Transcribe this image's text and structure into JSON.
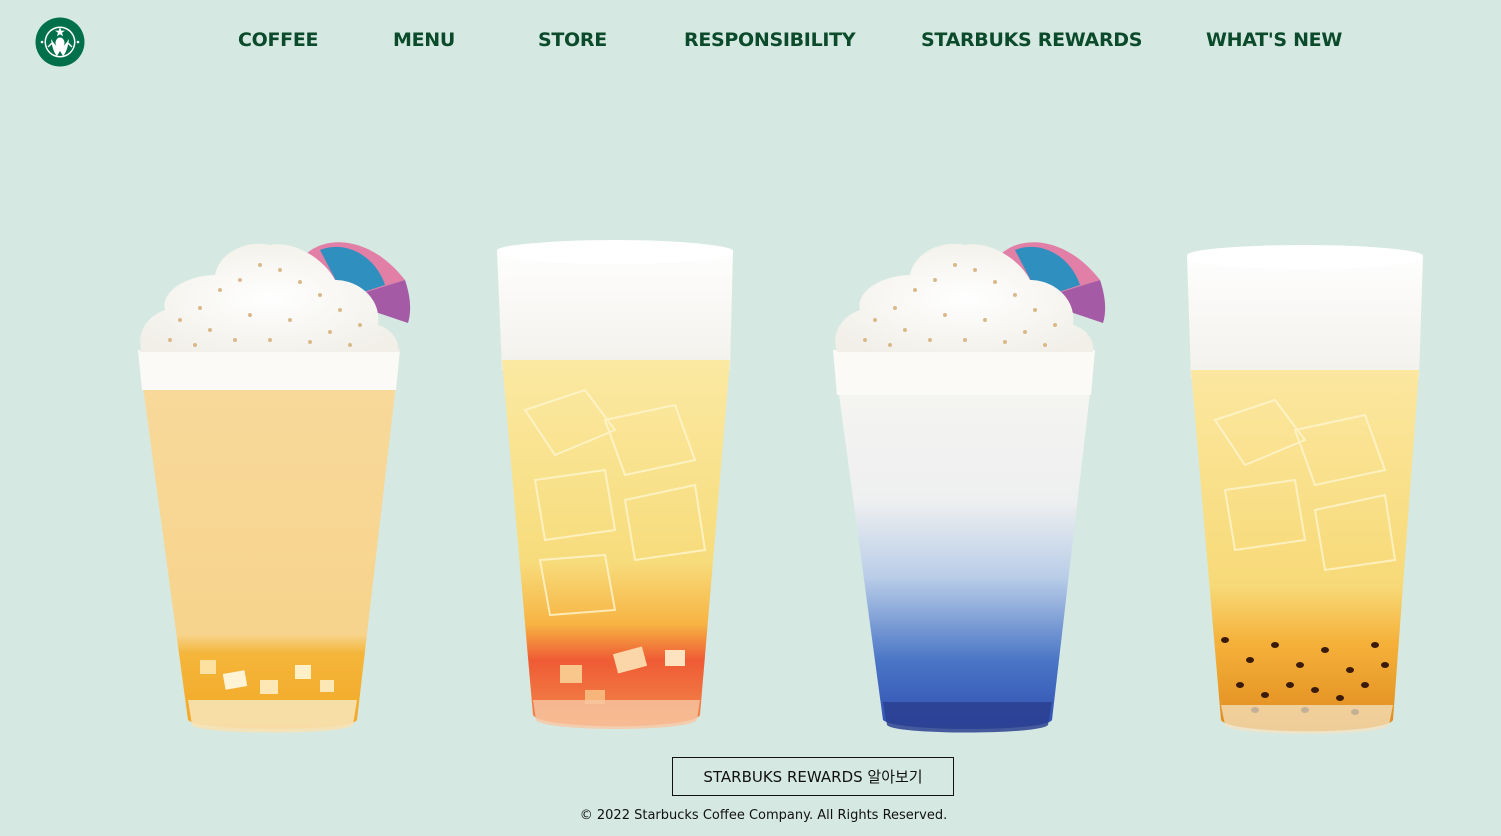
{
  "header": {
    "logo_icon": "starbucks-siren-logo-icon",
    "nav": [
      {
        "label": "COFFEE"
      },
      {
        "label": "MENU"
      },
      {
        "label": "STORE"
      },
      {
        "label": "RESPONSIBILITY"
      },
      {
        "label": "STARBUKS REWARDS"
      },
      {
        "label": "WHAT'S NEW"
      }
    ]
  },
  "main": {
    "drinks": [
      {
        "name": "drink-image-1"
      },
      {
        "name": "drink-image-2"
      },
      {
        "name": "drink-image-3"
      },
      {
        "name": "drink-image-4"
      }
    ],
    "rewards_button_label": "STARBUKS REWARDS 알아보기"
  },
  "footer": {
    "copyright": "© 2022 Starbucks Coffee Company. All Rights Reserved."
  },
  "colors": {
    "background": "#d5e9e2",
    "nav_text": "#0b4a2a",
    "logo_green": "#00704a"
  }
}
